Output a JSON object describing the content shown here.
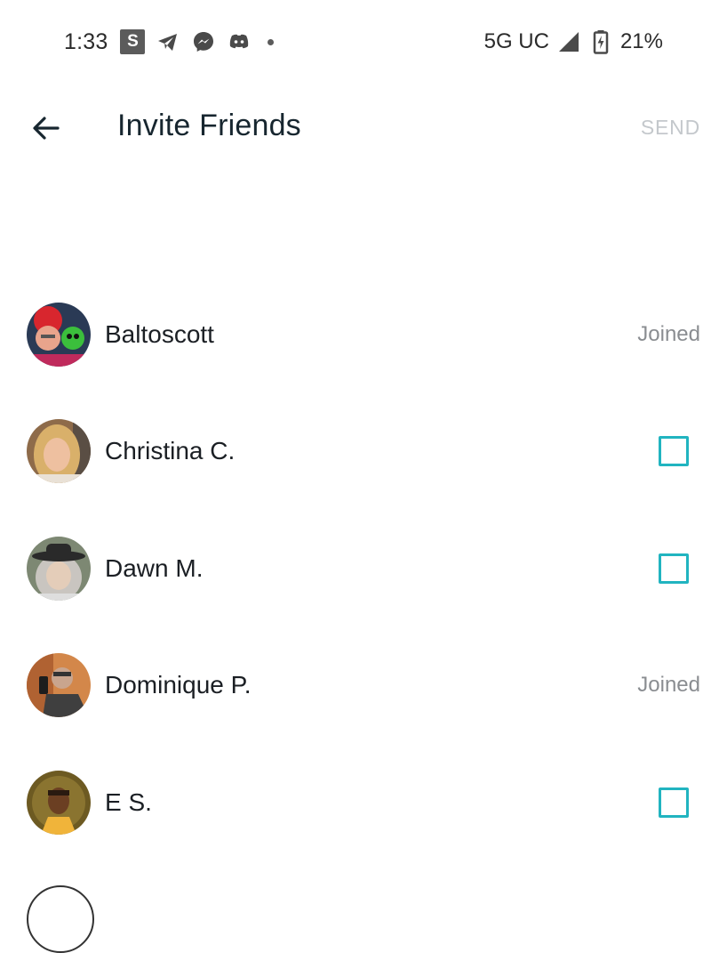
{
  "status_bar": {
    "time": "1:33",
    "badge_letter": "S",
    "network": "5G UC",
    "battery_percent": "21%",
    "icons": [
      "telegram-icon",
      "messenger-icon",
      "discord-icon",
      "signal-icon",
      "battery-charging-icon"
    ]
  },
  "app_bar": {
    "title": "Invite Friends",
    "send_label": "SEND"
  },
  "friends": [
    {
      "name": "Baltoscott",
      "status": "Joined"
    },
    {
      "name": "Christina C.",
      "status": ""
    },
    {
      "name": "Dawn M.",
      "status": ""
    },
    {
      "name": "Dominique P.",
      "status": "Joined"
    },
    {
      "name": "E S.",
      "status": ""
    }
  ],
  "colors": {
    "accent": "#21b4c0",
    "title": "#17262f",
    "muted": "#8a8d91",
    "disabled": "#c4c8cc"
  }
}
